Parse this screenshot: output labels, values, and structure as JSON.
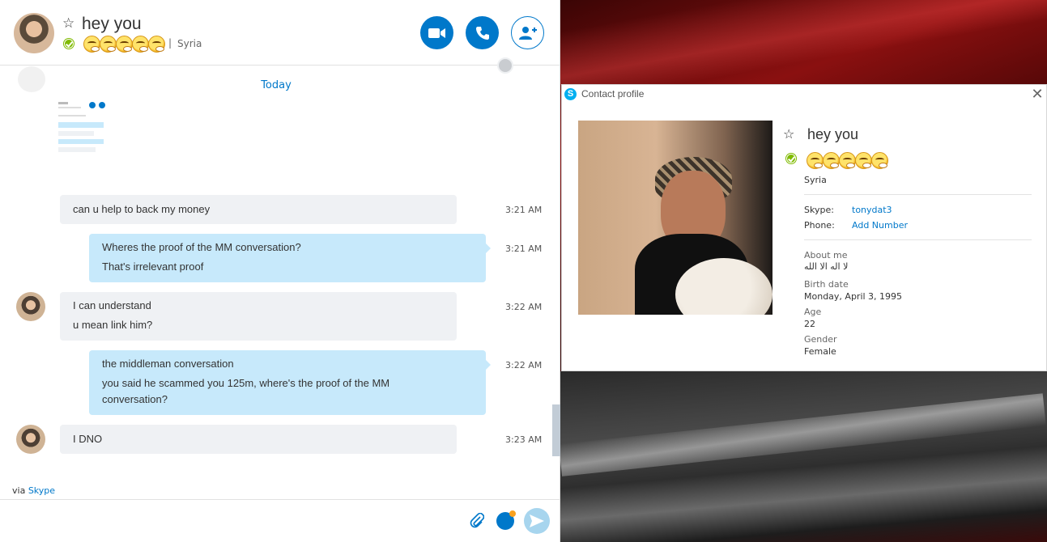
{
  "contact": {
    "name": "hey you",
    "location": "Syria",
    "separator": "|",
    "mood_emoji_count": 5
  },
  "header": {
    "video_call_label": "Video call",
    "audio_call_label": "Call",
    "add_people_label": "Add people"
  },
  "conversation": {
    "day_label": "Today",
    "messages": [
      {
        "direction": "in",
        "lines": [
          "can u help to back my money"
        ],
        "time": "3:21 AM"
      },
      {
        "direction": "out",
        "lines": [
          "Wheres the proof of the MM conversation?",
          "That's irrelevant proof"
        ],
        "time": "3:21 AM"
      },
      {
        "direction": "in",
        "lines": [
          "I can understand",
          "u mean link him?"
        ],
        "time": "3:22 AM"
      },
      {
        "direction": "out",
        "lines": [
          "the middleman conversation",
          "you said he scammed you 125m, where's the proof of the MM conversation?"
        ],
        "time": "3:22 AM"
      },
      {
        "direction": "in",
        "lines": [
          "I DNO"
        ],
        "time": "3:23 AM"
      }
    ]
  },
  "footer": {
    "via_prefix": "via",
    "via_link": "Skype"
  },
  "profile": {
    "window_title": "Contact profile",
    "name": "hey you",
    "location": "Syria",
    "skype_label": "Skype:",
    "skype_value": "tonydat3",
    "phone_label": "Phone:",
    "phone_value": "Add Number",
    "about_label": "About me",
    "about_value": "لا اله الا الله",
    "birth_label": "Birth date",
    "birth_value": "Monday, April 3, 1995",
    "age_label": "Age",
    "age_value": "22",
    "gender_label": "Gender",
    "gender_value": "Female"
  },
  "colors": {
    "accent": "#0078ca",
    "presence_online": "#7fba00",
    "outgoing_bubble": "#c7e9fb",
    "incoming_bubble": "#eff1f4"
  },
  "icons": [
    "star-icon",
    "presence-online-icon",
    "video-camera-icon",
    "phone-icon",
    "add-contact-icon",
    "globe-icon",
    "paperclip-icon",
    "emoticon-icon",
    "send-icon",
    "skype-logo-icon",
    "close-icon"
  ]
}
